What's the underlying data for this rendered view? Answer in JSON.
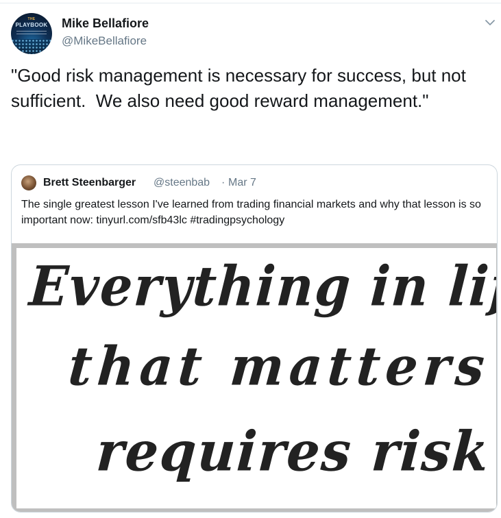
{
  "author": {
    "display_name": "Mike Bellafiore",
    "screen_name": "@MikeBellafiore",
    "avatar": {
      "title_small": "THE",
      "title": "PLAYBOOK"
    }
  },
  "tweet": {
    "text": "\"Good risk management is necessary for success, but not sufficient.  We also need good reward management.\""
  },
  "menu": {
    "icon": "chevron-down-icon"
  },
  "quoted_tweet": {
    "display_name": "Brett Steenbarger",
    "screen_name": "@steenbab",
    "separator": "·",
    "date": "Mar 7",
    "text": "The single greatest lesson I've learned from trading financial markets and why that lesson is so important now: tinyurl.com/sfb43lc #tradingpsychology",
    "image_text": {
      "line1": "Everything in life",
      "line2": "that matters",
      "line3": "requires risk"
    }
  },
  "colors": {
    "text_primary": "#14171a",
    "text_secondary": "#657786",
    "border": "#ccd6dd",
    "accent": "#1da1f2"
  }
}
